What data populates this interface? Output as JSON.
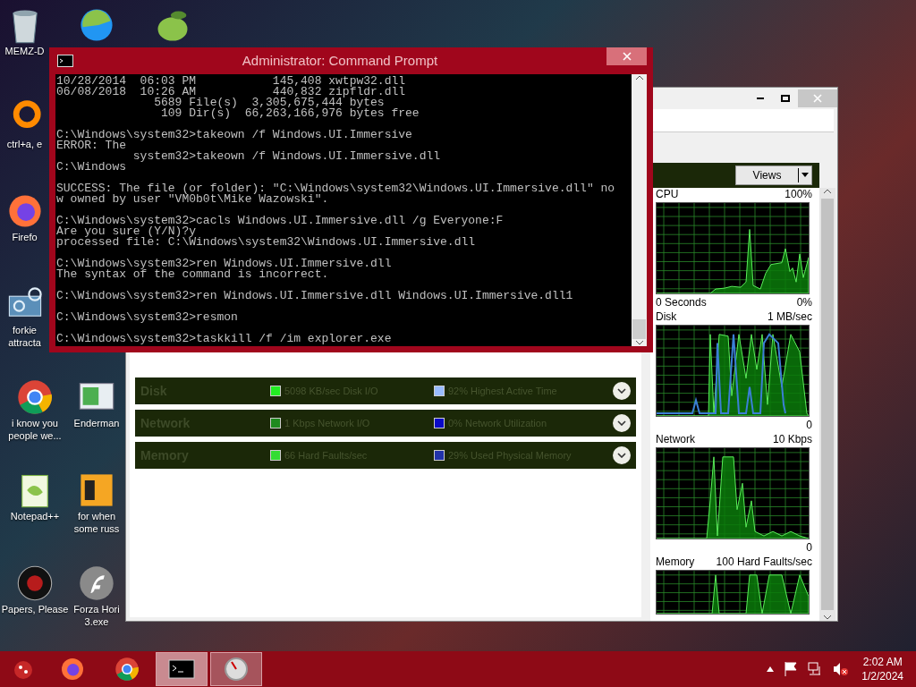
{
  "desktop": {
    "icons": [
      {
        "kind": "recycle-bin",
        "lines": [
          "MEMZ-D"
        ]
      },
      {
        "kind": "ring",
        "lines": [
          "ctrl+a, e"
        ]
      },
      {
        "kind": "firefox",
        "lines": [
          "Firefo"
        ]
      },
      {
        "kind": "gear-monitor",
        "lines": [
          "forkie",
          "attracta"
        ]
      },
      {
        "kind": "chrome",
        "lines": [
          "i know you",
          "people we..."
        ]
      },
      {
        "kind": "notepad",
        "lines": [
          "Notepad++"
        ]
      },
      {
        "kind": "badge",
        "lines": [
          "Papers, Please"
        ]
      },
      {
        "kind": "swirl"
      },
      {
        "kind": "monitor",
        "lines": [
          "Enderman"
        ]
      },
      {
        "kind": "document",
        "lines": [
          "for when",
          "some russ"
        ]
      },
      {
        "kind": "flash",
        "lines": [
          "Forza Hori",
          "3.exe"
        ]
      },
      {
        "kind": "lime"
      }
    ]
  },
  "cmd": {
    "title": "Administrator: Command Prompt",
    "blocks": [
      [
        "10/28/2014  06:03 PM           145,408 xwtpw32.dll",
        "06/08/2018  10:26 AM           440,832 zipfldr.dll",
        "              5689 File(s)  3,305,675,444 bytes",
        "               109 Dir(s)  66,263,166,976 bytes free"
      ],
      [
        "C:\\Windows\\system32>takeown /f Windows.UI.Immersive",
        "ERROR: The",
        "           system32>takeown /f Windows.UI.Immersive.dll",
        "C:\\Windows"
      ],
      [
        "SUCCESS: The file (or folder): \"C:\\Windows\\system32\\Windows.UI.Immersive.dll\" no",
        "w owned by user \"VM0b0t\\Mike Wazowski\"."
      ],
      [
        "C:\\Windows\\system32>cacls Windows.UI.Immersive.dll /g Everyone:F",
        "Are you sure (Y/N)?y",
        "processed file: C:\\Windows\\system32\\Windows.UI.Immersive.dll"
      ],
      [
        "C:\\Windows\\system32>ren Windows.UI.Immersive.dll",
        "The syntax of the command is incorrect."
      ],
      [
        "C:\\Windows\\system32>ren Windows.UI.Immersive.dll Windows.UI.Immersive.dll1"
      ],
      [
        "C:\\Windows\\system32>resmon"
      ],
      [
        "C:\\Windows\\system32>taskkill /f /im explorer.exe"
      ]
    ]
  },
  "resmon": {
    "views_button": "Views",
    "rows": [
      {
        "name": "Disk",
        "metrics": [
          {
            "text": "5098 KB/sec Disk I/O",
            "color": "#22ee22"
          },
          {
            "text": "92% Highest Active Time",
            "color": "#99bbff"
          }
        ]
      },
      {
        "name": "Network",
        "metrics": [
          {
            "text": "1 Kbps Network I/O",
            "color": "#1f8a1f"
          },
          {
            "text": "0% Network Utilization",
            "color": "#0a0ac8"
          }
        ]
      },
      {
        "name": "Memory",
        "metrics": [
          {
            "text": "66 Hard Faults/sec",
            "color": "#33dd33"
          },
          {
            "text": "29% Used Physical Memory",
            "color": "#2233aa"
          }
        ]
      }
    ],
    "graphs": [
      {
        "title": "CPU",
        "max": "100%",
        "span": "0 Seconds",
        "min": "0%"
      },
      {
        "title": "Disk",
        "max": "1 MB/sec",
        "min": "0"
      },
      {
        "title": "Network",
        "max": "10 Kbps",
        "min": "0"
      },
      {
        "title": "Memory",
        "max": "100 Hard Faults/sec"
      }
    ]
  },
  "taskbar": {
    "apps": [
      {
        "kind": "firefox",
        "running": false,
        "selected": false
      },
      {
        "kind": "chrome",
        "running": false,
        "selected": false
      },
      {
        "kind": "terminal",
        "running": true,
        "selected": true
      },
      {
        "kind": "gauge",
        "running": true,
        "selected": false
      }
    ],
    "tray": [
      {
        "kind": "up-arrow"
      },
      {
        "kind": "flag"
      },
      {
        "kind": "network"
      },
      {
        "kind": "volume-muted"
      }
    ],
    "time": "2:02 AM",
    "date": "1/2/2024"
  }
}
